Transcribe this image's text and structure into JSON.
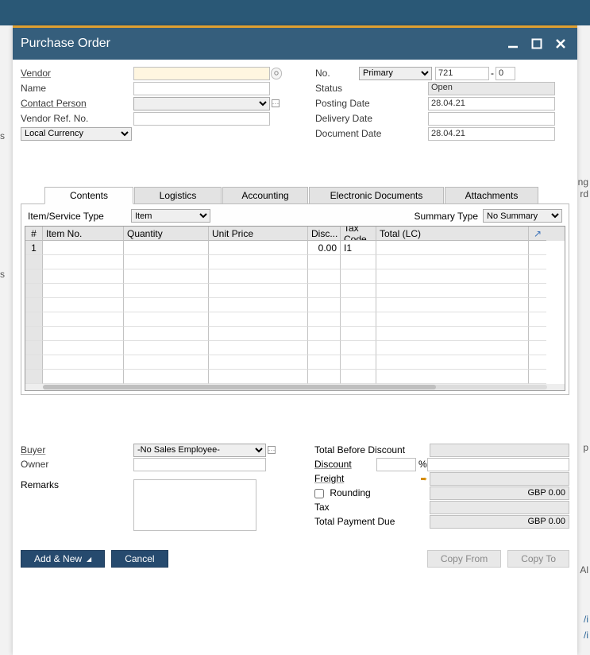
{
  "window": {
    "title": "Purchase Order"
  },
  "header": {
    "left": {
      "vendor_label": "Vendor",
      "vendor_value": "",
      "name_label": "Name",
      "name_value": "",
      "contact_label": "Contact Person",
      "contact_value": "",
      "vendorref_label": "Vendor Ref. No.",
      "vendorref_value": "",
      "currency_value": "Local Currency"
    },
    "right": {
      "no_label": "No.",
      "no_type": "Primary",
      "no_value": "721",
      "no_sub": "0",
      "status_label": "Status",
      "status_value": "Open",
      "posting_label": "Posting Date",
      "posting_value": "28.04.21",
      "delivery_label": "Delivery Date",
      "delivery_value": "",
      "docdate_label": "Document Date",
      "docdate_value": "28.04.21"
    }
  },
  "tabs": {
    "contents": "Contents",
    "logistics": "Logistics",
    "accounting": "Accounting",
    "edocs": "Electronic Documents",
    "attachments": "Attachments"
  },
  "contents_tab": {
    "itemservice_label": "Item/Service Type",
    "itemservice_value": "Item",
    "summarytype_label": "Summary Type",
    "summarytype_value": "No Summary",
    "columns": {
      "num": "#",
      "item": "Item No.",
      "qty": "Quantity",
      "price": "Unit Price",
      "disc": "Disc...",
      "tax": "Tax Code",
      "total": "Total (LC)"
    },
    "rows": [
      {
        "num": "1",
        "item": "",
        "qty": "",
        "price": "",
        "disc": "0.00",
        "tax": "I1",
        "total": ""
      }
    ]
  },
  "buyer_label": "Buyer",
  "buyer_value": "-No Sales Employee-",
  "owner_label": "Owner",
  "owner_value": "",
  "remarks_label": "Remarks",
  "remarks_value": "",
  "totals": {
    "before_label": "Total Before Discount",
    "before_value": "",
    "discount_label": "Discount",
    "discount_pct": "",
    "discount_pct_sym": "%",
    "discount_value": "",
    "freight_label": "Freight",
    "freight_value": "",
    "rounding_label": "Rounding",
    "rounding_value": "GBP 0.00",
    "tax_label": "Tax",
    "tax_value": "",
    "totaldue_label": "Total Payment Due",
    "totaldue_value": "GBP 0.00"
  },
  "footer": {
    "add": "Add & New",
    "cancel": "Cancel",
    "copyfrom": "Copy From",
    "copyto": "Copy To"
  }
}
